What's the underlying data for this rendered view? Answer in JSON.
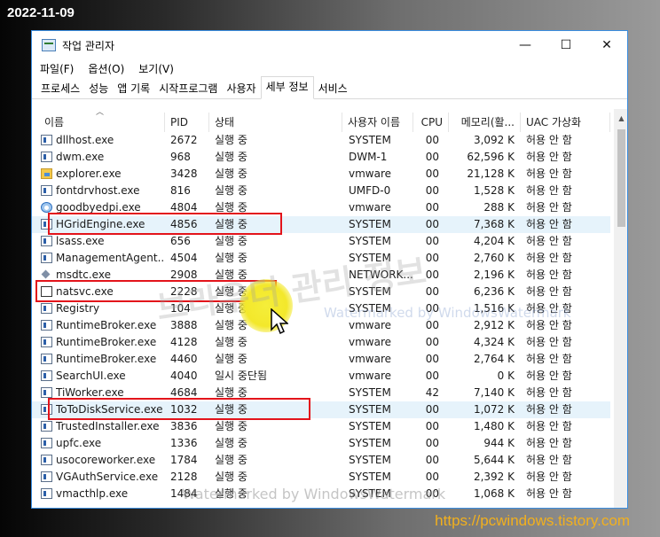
{
  "overlay": {
    "date": "2022-11-09",
    "site": "https://pcwindows.tistory.com",
    "watermark_big": "브라우더 관리 정보",
    "watermark_small": "Watermarked by WindowsWatermark",
    "watermark_bottom": "Watermarked by WindowsWatermark"
  },
  "window": {
    "title": "작업 관리자",
    "minimize": "—",
    "maximize": "☐",
    "close": "✕"
  },
  "menu": [
    "파일(F)",
    "옵션(O)",
    "보기(V)"
  ],
  "tabs": [
    {
      "label": "프로세스",
      "active": false
    },
    {
      "label": "성능",
      "active": false
    },
    {
      "label": "앱 기록",
      "active": false
    },
    {
      "label": "시작프로그램",
      "active": false
    },
    {
      "label": "사용자",
      "active": false
    },
    {
      "label": "세부 정보",
      "active": true
    },
    {
      "label": "서비스",
      "active": false
    }
  ],
  "columns": [
    "이름",
    "PID",
    "상태",
    "사용자 이름",
    "CPU",
    "메모리(활...",
    "UAC 가상화"
  ],
  "rows": [
    {
      "icon": "window",
      "name": "dllhost.exe",
      "pid": "2672",
      "status": "실행 중",
      "user": "SYSTEM",
      "cpu": "00",
      "mem": "3,092 K",
      "uac": "허용 안 함"
    },
    {
      "icon": "window",
      "name": "dwm.exe",
      "pid": "968",
      "status": "실행 중",
      "user": "DWM-1",
      "cpu": "00",
      "mem": "62,596 K",
      "uac": "허용 안 함"
    },
    {
      "icon": "folder",
      "name": "explorer.exe",
      "pid": "3428",
      "status": "실행 중",
      "user": "vmware",
      "cpu": "00",
      "mem": "21,128 K",
      "uac": "허용 안 함"
    },
    {
      "icon": "window",
      "name": "fontdrvhost.exe",
      "pid": "816",
      "status": "실행 중",
      "user": "UMFD-0",
      "cpu": "00",
      "mem": "1,528 K",
      "uac": "허용 안 함"
    },
    {
      "icon": "gear",
      "name": "goodbyedpi.exe",
      "pid": "4804",
      "status": "실행 중",
      "user": "vmware",
      "cpu": "00",
      "mem": "288 K",
      "uac": "허용 안 함"
    },
    {
      "icon": "window",
      "name": "HGridEngine.exe",
      "pid": "4856",
      "status": "실행 중",
      "user": "SYSTEM",
      "cpu": "00",
      "mem": "7,368 K",
      "uac": "허용 안 함"
    },
    {
      "icon": "window",
      "name": "lsass.exe",
      "pid": "656",
      "status": "실행 중",
      "user": "SYSTEM",
      "cpu": "00",
      "mem": "4,204 K",
      "uac": "허용 안 함"
    },
    {
      "icon": "window",
      "name": "ManagementAgent...",
      "pid": "4504",
      "status": "실행 중",
      "user": "SYSTEM",
      "cpu": "00",
      "mem": "2,760 K",
      "uac": "허용 안 함"
    },
    {
      "icon": "dtc",
      "name": "msdtc.exe",
      "pid": "2908",
      "status": "실행 중",
      "user": "NETWORK...",
      "cpu": "00",
      "mem": "2,196 K",
      "uac": "허용 안 함"
    },
    {
      "icon": "blank",
      "name": "natsvc.exe",
      "pid": "2228",
      "status": "실행 중",
      "user": "SYSTEM",
      "cpu": "00",
      "mem": "6,236 K",
      "uac": "허용 안 함"
    },
    {
      "icon": "window",
      "name": "Registry",
      "pid": "104",
      "status": "실행 중",
      "user": "SYSTEM",
      "cpu": "00",
      "mem": "1,516 K",
      "uac": "허용 안 함"
    },
    {
      "icon": "window",
      "name": "RuntimeBroker.exe",
      "pid": "3888",
      "status": "실행 중",
      "user": "vmware",
      "cpu": "00",
      "mem": "2,912 K",
      "uac": "허용 안 함"
    },
    {
      "icon": "window",
      "name": "RuntimeBroker.exe",
      "pid": "4128",
      "status": "실행 중",
      "user": "vmware",
      "cpu": "00",
      "mem": "4,324 K",
      "uac": "허용 안 함"
    },
    {
      "icon": "window",
      "name": "RuntimeBroker.exe",
      "pid": "4460",
      "status": "실행 중",
      "user": "vmware",
      "cpu": "00",
      "mem": "2,764 K",
      "uac": "허용 안 함"
    },
    {
      "icon": "window",
      "name": "SearchUI.exe",
      "pid": "4040",
      "status": "일시 중단됨",
      "user": "vmware",
      "cpu": "00",
      "mem": "0 K",
      "uac": "허용 안 함"
    },
    {
      "icon": "window",
      "name": "TiWorker.exe",
      "pid": "4684",
      "status": "실행 중",
      "user": "SYSTEM",
      "cpu": "42",
      "mem": "7,140 K",
      "uac": "허용 안 함"
    },
    {
      "icon": "window",
      "name": "ToToDiskService.exe",
      "pid": "1032",
      "status": "실행 중",
      "user": "SYSTEM",
      "cpu": "00",
      "mem": "1,072 K",
      "uac": "허용 안 함"
    },
    {
      "icon": "window",
      "name": "TrustedInstaller.exe",
      "pid": "3836",
      "status": "실행 중",
      "user": "SYSTEM",
      "cpu": "00",
      "mem": "1,480 K",
      "uac": "허용 안 함"
    },
    {
      "icon": "window",
      "name": "upfc.exe",
      "pid": "1336",
      "status": "실행 중",
      "user": "SYSTEM",
      "cpu": "00",
      "mem": "944 K",
      "uac": "허용 안 함"
    },
    {
      "icon": "window",
      "name": "usocoreworker.exe",
      "pid": "1784",
      "status": "실행 중",
      "user": "SYSTEM",
      "cpu": "00",
      "mem": "5,644 K",
      "uac": "허용 안 함"
    },
    {
      "icon": "window",
      "name": "VGAuthService.exe",
      "pid": "2128",
      "status": "실행 중",
      "user": "SYSTEM",
      "cpu": "00",
      "mem": "2,392 K",
      "uac": "허용 안 함"
    },
    {
      "icon": "window",
      "name": "vmacthlp.exe",
      "pid": "1484",
      "status": "실행 중",
      "user": "SYSTEM",
      "cpu": "00",
      "mem": "1,068 K",
      "uac": "허용 안 함"
    }
  ],
  "selected_rows": [
    "HGridEngine.exe",
    "ToToDiskService.exe"
  ],
  "colors": {
    "highlight_box": "#e3141b",
    "selection": "#e6f3fb",
    "window_border": "#3a8de0",
    "site_text": "#f2b01e"
  }
}
